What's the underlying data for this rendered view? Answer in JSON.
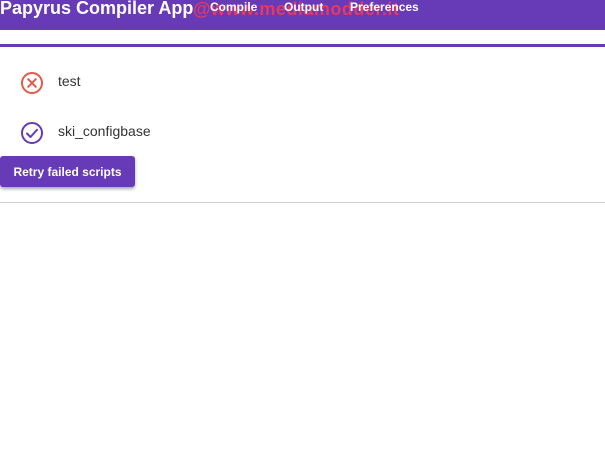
{
  "app": {
    "title": "Papyrus Compiler App",
    "watermark": "@www.mediamodder.it"
  },
  "nav": {
    "tabs": [
      {
        "label": "Compile"
      },
      {
        "label": "Output"
      },
      {
        "label": "Preferences"
      }
    ]
  },
  "scripts": [
    {
      "name": "test",
      "status": "failed",
      "icon": "x-circle-icon",
      "color": "#e05a4a"
    },
    {
      "name": "ski_configbase",
      "status": "success",
      "icon": "check-circle-icon",
      "color": "#673ab7"
    }
  ],
  "actions": {
    "retry_label": "Retry failed scripts"
  },
  "colors": {
    "primary": "#673ab7",
    "error": "#e05a4a"
  }
}
